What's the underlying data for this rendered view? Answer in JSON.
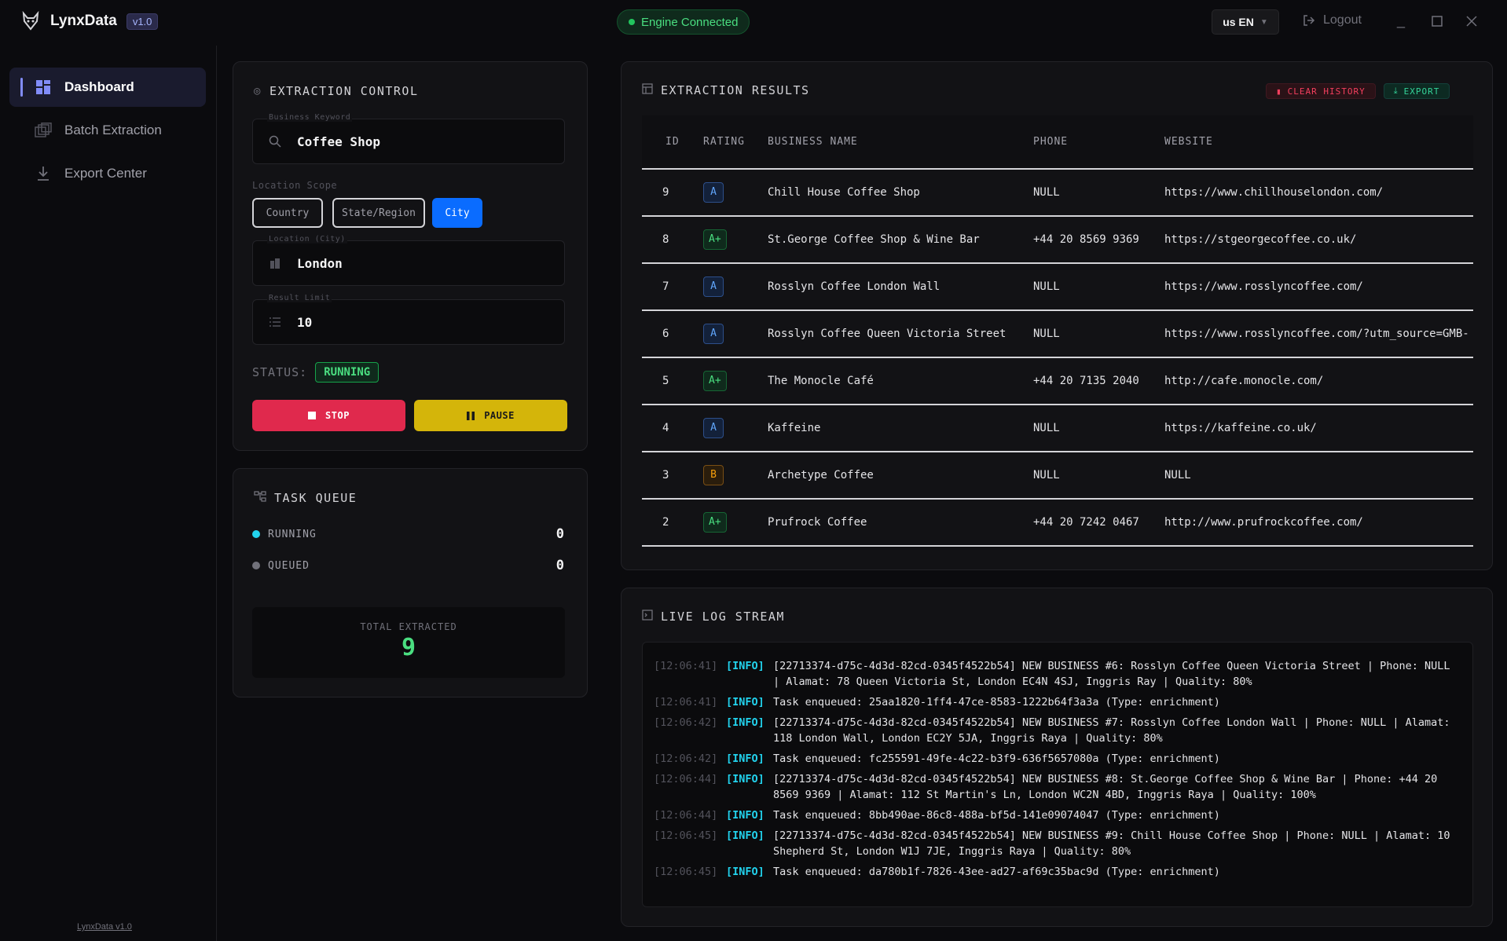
{
  "app": {
    "name": "LynxData",
    "version": "v1.0",
    "engine_status": "Engine Connected",
    "language": "us EN",
    "logout": "Logout",
    "footer": "LynxData v1.0"
  },
  "sidebar": {
    "items": [
      {
        "label": "Dashboard",
        "icon": "grid-icon",
        "active": true
      },
      {
        "label": "Batch Extraction",
        "icon": "layers-icon",
        "active": false
      },
      {
        "label": "Export Center",
        "icon": "download-icon",
        "active": false
      }
    ]
  },
  "control": {
    "title": "EXTRACTION CONTROL",
    "keyword_label": "Business Keyword",
    "keyword_value": "Coffee Shop",
    "scope_label": "Location Scope",
    "scope_options": [
      "Country",
      "State/Region",
      "City"
    ],
    "scope_selected": "City",
    "location_label": "Location (City)",
    "location_value": "London",
    "limit_label": "Result Limit",
    "limit_value": "10",
    "status_label": "STATUS:",
    "status_value": "RUNNING",
    "stop_label": "STOP",
    "pause_label": "PAUSE"
  },
  "queue": {
    "title": "TASK QUEUE",
    "running_label": "RUNNING",
    "running_value": "0",
    "queued_label": "QUEUED",
    "queued_value": "0",
    "total_label": "TOTAL EXTRACTED",
    "total_value": "9"
  },
  "results": {
    "title": "EXTRACTION RESULTS",
    "clear_label": "CLEAR HISTORY",
    "export_label": "EXPORT",
    "columns": [
      "ID",
      "RATING",
      "BUSINESS NAME",
      "PHONE",
      "WEBSITE"
    ],
    "rows": [
      {
        "id": "9",
        "rating": "A",
        "name": "Chill House Coffee Shop",
        "phone": "NULL",
        "website": "https://www.chillhouselondon.com/"
      },
      {
        "id": "8",
        "rating": "A+",
        "name": "St.George Coffee Shop & Wine Bar",
        "phone": "+44 20 8569 9369",
        "website": "https://stgeorgecoffee.co.uk/"
      },
      {
        "id": "7",
        "rating": "A",
        "name": "Rosslyn Coffee London Wall",
        "phone": "NULL",
        "website": "https://www.rosslyncoffee.com/"
      },
      {
        "id": "6",
        "rating": "A",
        "name": "Rosslyn Coffee Queen Victoria Street",
        "phone": "NULL",
        "website": "https://www.rosslyncoffee.com/?utm_source=GMB-"
      },
      {
        "id": "5",
        "rating": "A+",
        "name": "The Monocle Café",
        "phone": "+44 20 7135 2040",
        "website": "http://cafe.monocle.com/"
      },
      {
        "id": "4",
        "rating": "A",
        "name": "Kaffeine",
        "phone": "NULL",
        "website": "https://kaffeine.co.uk/"
      },
      {
        "id": "3",
        "rating": "B",
        "name": "Archetype Coffee",
        "phone": "NULL",
        "website": "NULL"
      },
      {
        "id": "2",
        "rating": "A+",
        "name": "Prufrock Coffee",
        "phone": "+44 20 7242 0467",
        "website": "http://www.prufrockcoffee.com/"
      }
    ]
  },
  "logs": {
    "title": "LIVE LOG STREAM",
    "entries": [
      {
        "time": "[12:06:41]",
        "level": "[INFO]",
        "msg": "[22713374-d75c-4d3d-82cd-0345f4522b54] NEW BUSINESS #6: Rosslyn Coffee Queen Victoria Street | Phone: NULL | Alamat: 78 Queen Victoria St, London EC4N 4SJ, Inggris Ray | Quality: 80%"
      },
      {
        "time": "[12:06:41]",
        "level": "[INFO]",
        "msg": "Task enqueued: 25aa1820-1ff4-47ce-8583-1222b64f3a3a (Type: enrichment)"
      },
      {
        "time": "[12:06:42]",
        "level": "[INFO]",
        "msg": "[22713374-d75c-4d3d-82cd-0345f4522b54] NEW BUSINESS #7: Rosslyn Coffee London Wall | Phone: NULL | Alamat: 118 London Wall, London EC2Y 5JA, Inggris Raya | Quality: 80%"
      },
      {
        "time": "[12:06:42]",
        "level": "[INFO]",
        "msg": "Task enqueued: fc255591-49fe-4c22-b3f9-636f5657080a (Type: enrichment)"
      },
      {
        "time": "[12:06:44]",
        "level": "[INFO]",
        "msg": "[22713374-d75c-4d3d-82cd-0345f4522b54] NEW BUSINESS #8: St.George Coffee Shop & Wine Bar | Phone: +44 20 8569 9369 | Alamat: 112 St Martin's Ln, London WC2N 4BD, Inggris Raya | Quality: 100%"
      },
      {
        "time": "[12:06:44]",
        "level": "[INFO]",
        "msg": "Task enqueued: 8bb490ae-86c8-488a-bf5d-141e09074047 (Type: enrichment)"
      },
      {
        "time": "[12:06:45]",
        "level": "[INFO]",
        "msg": "[22713374-d75c-4d3d-82cd-0345f4522b54] NEW BUSINESS #9: Chill House Coffee Shop | Phone: NULL | Alamat: 10 Shepherd St, London W1J 7JE, Inggris Raya | Quality: 80%"
      },
      {
        "time": "[12:06:45]",
        "level": "[INFO]",
        "msg": "Task enqueued: da780b1f-7826-43ee-ad27-af69c35bac9d (Type: enrichment)"
      }
    ]
  }
}
